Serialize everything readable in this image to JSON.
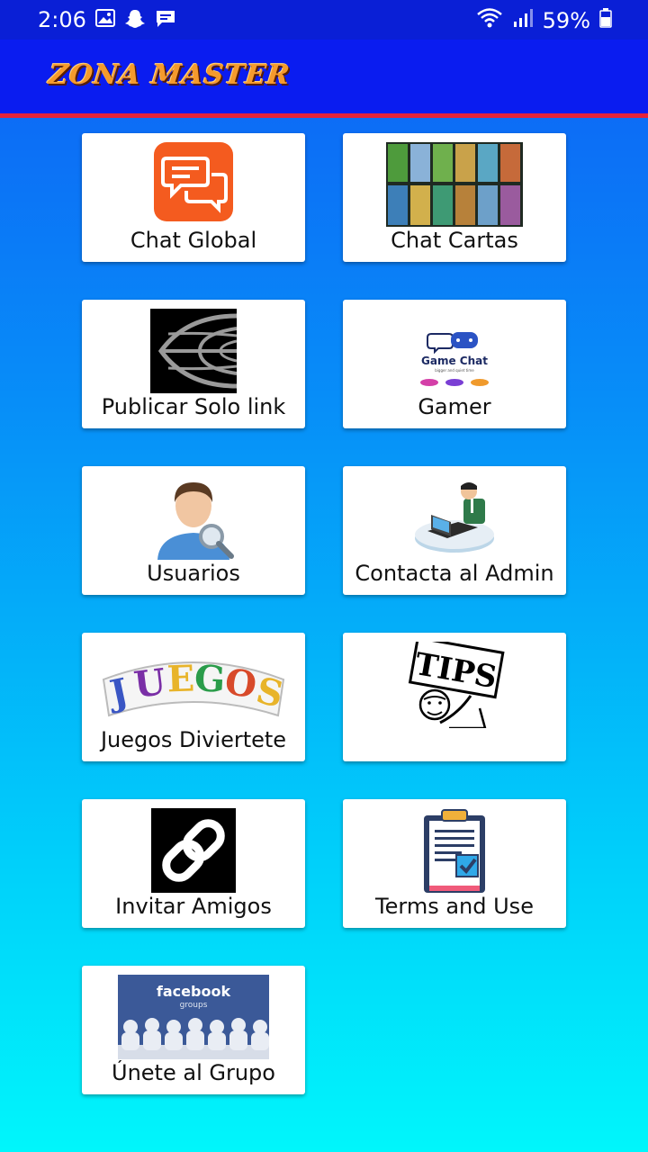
{
  "status_bar": {
    "time": "2:06",
    "battery": "59%"
  },
  "app": {
    "title": "ZONA MASTER"
  },
  "menu": [
    {
      "label": "Chat Global"
    },
    {
      "label": "Chat Cartas"
    },
    {
      "label": "Publicar Solo link"
    },
    {
      "label": "Gamer"
    },
    {
      "label": "Usuarios"
    },
    {
      "label": "Contacta al Admin"
    },
    {
      "label": "Juegos Diviertete"
    },
    {
      "label": ""
    },
    {
      "label": "Invitar Amigos"
    },
    {
      "label": "Terms and Use"
    },
    {
      "label": "Únete al Grupo"
    }
  ],
  "images": {
    "game_chat": {
      "title": "Game Chat",
      "subtitle": "bigger and quiet time"
    },
    "juegos": "JUEGOS",
    "tips": "TIPS",
    "facebook": {
      "brand": "facebook",
      "sub": "groups"
    }
  },
  "colors": {
    "status_bar": "#0a1fd6",
    "app_bar": "#0a1cf0",
    "app_bar_border": "#e5233a",
    "bg_top": "#0f5ff5",
    "bg_bottom": "#00f6fb"
  }
}
